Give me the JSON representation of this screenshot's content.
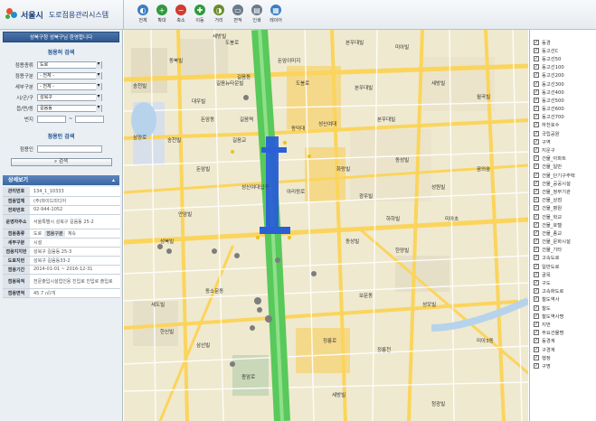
{
  "header": {
    "logo_text": "서울시",
    "app_title": "도로점용관리시스템",
    "tools": [
      {
        "label": "전체",
        "icon": "globe-icon",
        "color": "#3b7fc4",
        "glyph": "◐"
      },
      {
        "label": "확대",
        "icon": "zoom-in-icon",
        "color": "#2f9a3a",
        "glyph": "+"
      },
      {
        "label": "축소",
        "icon": "zoom-out-icon",
        "color": "#d23b2f",
        "glyph": "−"
      },
      {
        "label": "이동",
        "icon": "move-icon",
        "color": "#2f9a3a",
        "glyph": "✚"
      },
      {
        "label": "거리",
        "icon": "distance-icon",
        "color": "#6a8c2c",
        "glyph": "◑"
      },
      {
        "label": "면적",
        "icon": "area-icon",
        "color": "#6b7a88",
        "glyph": "▭"
      },
      {
        "label": "인쇄",
        "icon": "print-icon",
        "color": "#6b7a88",
        "glyph": "▤"
      },
      {
        "label": "레이어",
        "icon": "layers-icon",
        "color": "#3b7fc4",
        "glyph": "▦"
      }
    ]
  },
  "sidebar": {
    "welcome": "성북구청 성북구님 환영합니다",
    "search_title": "점용허 검색",
    "fields": [
      {
        "label": "점용종류",
        "value": "도로"
      },
      {
        "label": "점용구분",
        "value": "- 전체 -"
      },
      {
        "label": "세부구분",
        "value": "- 전체 -"
      },
      {
        "label": "시/군/구",
        "value": "성북구"
      },
      {
        "label": "읍/면/동",
        "value": "길음동"
      }
    ],
    "bunji_label": "번지",
    "bunji_sep": "~",
    "person_title": "점용인 검색",
    "person_label": "점용인",
    "search_button": "검색",
    "detail_title": "상세보기",
    "detail_toggle": "▴",
    "detail": {
      "mgmt_no_label": "관리번호",
      "mgmt_no": "134_1_10333",
      "company_label": "점용업체",
      "company": "(주)와이드미디어",
      "phone_label": "전화번호",
      "phone": "02-944-1052",
      "address_label": "운영자주소",
      "address": "서울특별시 성북구 길음동 25-2",
      "type_label": "점용종류",
      "type": "도로",
      "kind_label": "점용구분",
      "kind": "계속",
      "detail_kind_label": "세부구분",
      "detail_kind": "시설",
      "location_label": "점용지지번",
      "location": "성북구 길음동 25-3",
      "road_label": "도로지번",
      "road": "성북구 길음동33-2",
      "period_label": "점용기간",
      "period": "2014-01-01 ~ 2016-12-31",
      "purpose_label": "점용목적",
      "purpose": "전문출입시설업인용 진입로 진입로 출입로",
      "area_label": "점용면적",
      "area": "45.7 ㎡/개"
    }
  },
  "map": {
    "labels": [
      "세방빌",
      "도봉로",
      "돈암이미지",
      "도봉로",
      "송천빌",
      "동북빌",
      "길음뉴타운빌",
      "길음동",
      "대우빌",
      "돈암동",
      "길음역",
      "삼양로",
      "송천빌",
      "동덕대",
      "길음교",
      "성신여대",
      "본우대빌",
      "미아빌",
      "본우대빌",
      "세방빌",
      "본우대빌",
      "월곡빌",
      "동성빌",
      "화랑빌",
      "성원빌",
      "광우빌",
      "하하빌",
      "미아초",
      "돈암빌",
      "꿈의숲",
      "아리랑로",
      "성신여대입구",
      "안암빌",
      "성북빌",
      "동성빌",
      "한양빌",
      "동소문동",
      "세도빌",
      "보문동",
      "성모빌",
      "한신빌",
      "삼선빌",
      "정릉로",
      "정릉천",
      "미아3동",
      "종암로",
      "세방빌",
      "청광빌"
    ]
  },
  "layers": {
    "items": [
      {
        "label": "동경",
        "checked": true
      },
      {
        "label": "동고선C",
        "checked": true
      },
      {
        "label": "동고선50",
        "checked": true
      },
      {
        "label": "동고선100",
        "checked": true
      },
      {
        "label": "동고선200",
        "checked": true
      },
      {
        "label": "동고선300",
        "checked": true
      },
      {
        "label": "동고선400",
        "checked": true
      },
      {
        "label": "동고선500",
        "checked": true
      },
      {
        "label": "동고선600",
        "checked": true
      },
      {
        "label": "동고선700",
        "checked": true
      },
      {
        "label": "하천호수",
        "checked": true
      },
      {
        "label": "국립공원",
        "checked": true
      },
      {
        "label": "구역",
        "checked": true
      },
      {
        "label": "지운구",
        "checked": true
      },
      {
        "label": "건물_아파트",
        "checked": true
      },
      {
        "label": "건물_일반",
        "checked": true
      },
      {
        "label": "건물_단기구주택",
        "checked": true
      },
      {
        "label": "건물_공공시설",
        "checked": true
      },
      {
        "label": "건물_정부기관",
        "checked": true
      },
      {
        "label": "건물_상점",
        "checked": true
      },
      {
        "label": "건물_병원",
        "checked": true
      },
      {
        "label": "건물_학교",
        "checked": true
      },
      {
        "label": "건물_호텔",
        "checked": true
      },
      {
        "label": "건물_종교",
        "checked": true
      },
      {
        "label": "건물_문화시설",
        "checked": true
      },
      {
        "label": "건물_기타",
        "checked": true
      },
      {
        "label": "고속도로",
        "checked": true
      },
      {
        "label": "일반도로",
        "checked": true
      },
      {
        "label": "골목",
        "checked": true
      },
      {
        "label": "구도",
        "checked": true
      },
      {
        "label": "고속화도로",
        "checked": true
      },
      {
        "label": "철도역사",
        "checked": true
      },
      {
        "label": "철도",
        "checked": true
      },
      {
        "label": "철도역사명",
        "checked": true
      },
      {
        "label": "지번",
        "checked": true
      },
      {
        "label": "주요건물명",
        "checked": true
      },
      {
        "label": "동경계",
        "checked": true
      },
      {
        "label": "구경계",
        "checked": true
      },
      {
        "label": "행정",
        "checked": true
      },
      {
        "label": "구명",
        "checked": true
      }
    ]
  }
}
